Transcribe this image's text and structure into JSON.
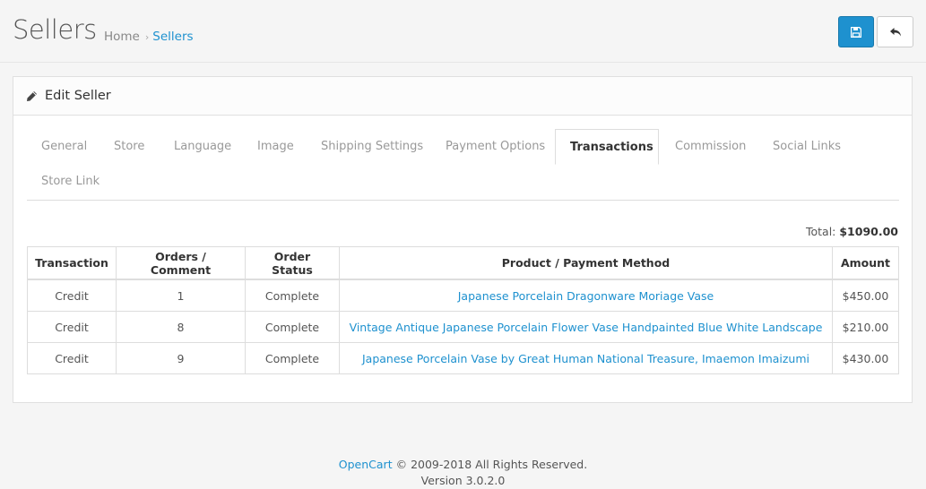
{
  "header": {
    "title": "Sellers",
    "breadcrumb": [
      {
        "label": "Home"
      },
      {
        "label": "Sellers"
      }
    ],
    "save_icon": "save-icon",
    "back_icon": "reply-icon"
  },
  "panel": {
    "icon": "pencil-icon",
    "title": "Edit Seller"
  },
  "tabs": [
    {
      "label": "General"
    },
    {
      "label": "Store"
    },
    {
      "label": "Language"
    },
    {
      "label": "Image"
    },
    {
      "label": "Shipping Settings"
    },
    {
      "label": "Payment Options"
    },
    {
      "label": "Transactions",
      "active": true
    },
    {
      "label": "Commission"
    },
    {
      "label": "Social Links"
    },
    {
      "label": "Store Link"
    }
  ],
  "transactions": {
    "total_label": "Total:",
    "total_value": "$1090.00",
    "columns": [
      "Transaction",
      "Orders / Comment",
      "Order Status",
      "Product / Payment Method",
      "Amount"
    ],
    "rows": [
      {
        "type": "Credit",
        "order": "1",
        "status": "Complete",
        "product": "Japanese Porcelain Dragonware Moriage Vase",
        "amount": "$450.00"
      },
      {
        "type": "Credit",
        "order": "8",
        "status": "Complete",
        "product": "Vintage Antique Japanese Porcelain Flower Vase Handpainted Blue White Landscape",
        "amount": "$210.00"
      },
      {
        "type": "Credit",
        "order": "9",
        "status": "Complete",
        "product": "Japanese Porcelain Vase by Great Human National Treasure, Imaemon Imaizumi",
        "amount": "$430.00"
      }
    ]
  },
  "footer": {
    "brand": "OpenCart",
    "copyright": "© 2009-2018 All Rights Reserved.",
    "version": "Version 3.0.2.0"
  },
  "colors": {
    "accent": "#1e91cf",
    "background": "#f5f5f5"
  }
}
